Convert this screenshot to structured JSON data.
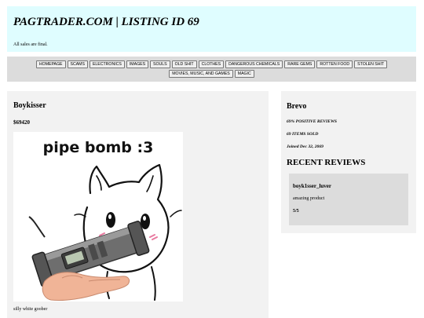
{
  "header": {
    "title": "PAGTRADER.COM | LISTING ID 69",
    "tagline": "All sales are final."
  },
  "nav": {
    "items": [
      "HOMEPAGE",
      "SCAMS",
      "ELECTRONICS",
      "IMAGES",
      "SOULS",
      "OLD SHIT",
      "CLOTHES",
      "DANGEROUS CHEMICALS",
      "RARE GEMS",
      "ROTTEN FOOD",
      "STOLEN SHIT",
      "MOVIES, MUSIC, AND GAMES",
      "MAGIC"
    ]
  },
  "listing": {
    "title": "Boykisser",
    "price": "$69420",
    "image_caption": "pipe bomb :3",
    "description": "silly white goober"
  },
  "seller": {
    "name": "Brevo",
    "positive_reviews": "69% POSITIVE REVIEWS",
    "items_sold": "69 ITEMS SOLD",
    "joined": "Joined Dec 32, 2069",
    "reviews_heading": "RECENT REVIEWS",
    "reviews": [
      {
        "user": "boyk1sser_luver",
        "text": "amazing product",
        "score": "5/5"
      }
    ]
  },
  "colors": {
    "header_bg": "#dffdff",
    "navbar_bg": "#dcdcdc",
    "panel_bg": "#f2f2f2",
    "review_bg": "#dcdcdc",
    "blush": "#e87aa0"
  }
}
